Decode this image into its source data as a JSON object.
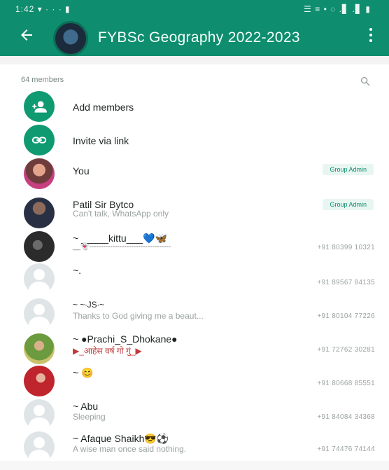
{
  "status_bar": {
    "left": "1:42 ▾ · · · ▮",
    "right": "☰ ≡ • ◌ .▋ .▋ ▮"
  },
  "header": {
    "title": "FYBSc Geography 2022-2023"
  },
  "members": {
    "count_label": "64 members"
  },
  "actions": [
    {
      "label": "Add members"
    },
    {
      "label": "Invite via link"
    }
  ],
  "rows": [
    {
      "name": "You",
      "subtitle": "",
      "phone": "",
      "badge": "Group Admin"
    },
    {
      "name": "Patil Sir Bytco",
      "subtitle": "Can't talk, WhatsApp only",
      "phone": "",
      "badge": "Group Admin"
    },
    {
      "name": "~ _____kittu___💙🦋",
      "subtitle": "__👻-----------------------------------",
      "phone": "+91 80399 10321",
      "badge": ""
    },
    {
      "name": "~.",
      "subtitle": "",
      "phone": "+91 89567 84135",
      "badge": ""
    },
    {
      "name": "~ ~∙JS∙~",
      "subtitle": "Thanks to God giving me a beaut...",
      "phone": "+91 80104 77226",
      "badge": ""
    },
    {
      "name": "~ ●Prachi_S_Dhokane●",
      "subtitle": "▶_आहेस वर्ष गो गुं_▶",
      "phone": "+91 72762 30281",
      "badge": ""
    },
    {
      "name": "~ 😊",
      "subtitle": "",
      "phone": "+91 80668 85551",
      "badge": ""
    },
    {
      "name": "~ Abu",
      "subtitle": "Sleeping",
      "phone": "+91 84084 34368",
      "badge": ""
    },
    {
      "name": "~ Afaque Shaikh😎⚽",
      "subtitle": "A wise man once said nothing.",
      "phone": "+91 74476 74144",
      "badge": ""
    }
  ],
  "colors": {
    "brand": "#0f8d6f",
    "action": "#0f9a72",
    "badge_bg": "#e8f6f1"
  }
}
